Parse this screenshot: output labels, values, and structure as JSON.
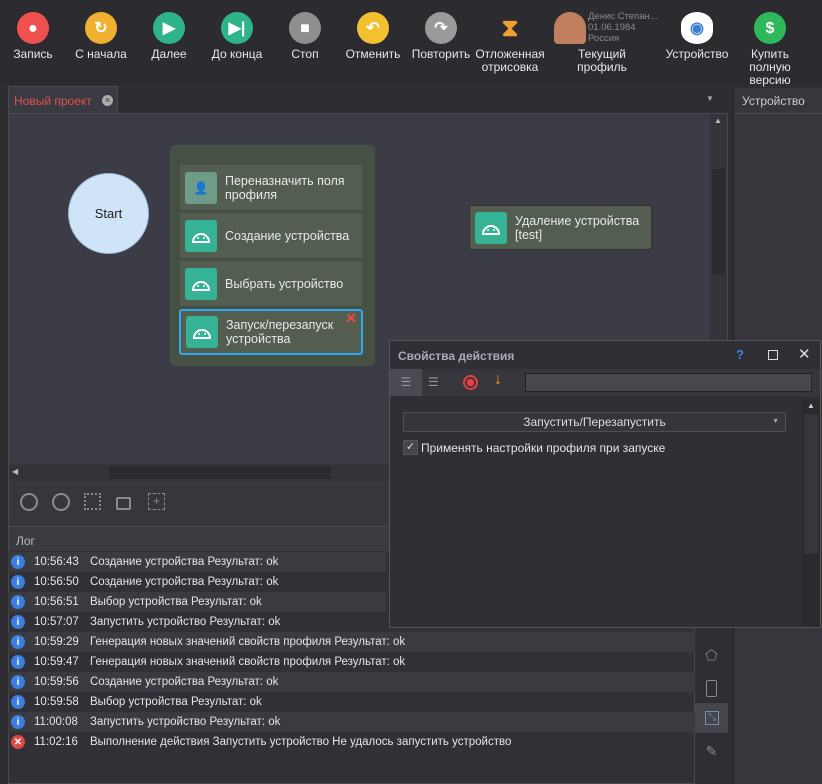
{
  "toolbar": {
    "items": [
      {
        "label": "Запись",
        "icon": "record-icon",
        "color": "#f05050"
      },
      {
        "label": "С начала",
        "icon": "restart-icon",
        "color": "#f0b030"
      },
      {
        "label": "Далее",
        "icon": "play-icon",
        "color": "#2fb38a"
      },
      {
        "label": "До конца",
        "icon": "skip-end-icon",
        "color": "#2fb38a"
      },
      {
        "label": "Стоп",
        "icon": "stop-icon",
        "color": "#8e8e8e"
      },
      {
        "label": "Отменить",
        "icon": "undo-icon",
        "color": "#f5c030"
      },
      {
        "label": "Повторить",
        "icon": "redo-icon",
        "color": "#9a9a9a"
      },
      {
        "label": "Отложенная отрисовка",
        "icon": "hourglass-icon"
      },
      {
        "label": "Текущий профиль",
        "icon": "profile-avatar-icon"
      },
      {
        "label": "Устройство",
        "icon": "eye-icon"
      },
      {
        "label": "Купить полную версию",
        "icon": "dollar-icon",
        "color": "#2eb85c"
      }
    ],
    "profile": {
      "name": "Денис Степан...",
      "date": "01.06.1984",
      "country": "Россия"
    }
  },
  "tabs": {
    "active": "Новый проект",
    "right_panel": "Устройство"
  },
  "canvas": {
    "start": "Start",
    "group": [
      "Переназначить поля профиля",
      "Создание устройства",
      "Выбрать устройство",
      "Запуск/перезапуск устройства"
    ],
    "standalone": "Удаление устройства [test]"
  },
  "dialog": {
    "title": "Свойства действия",
    "help": "?",
    "select_value": "Запустить/Перезапустить",
    "checkbox_label": "Применять настройки профиля при запуске",
    "checkbox_checked": true
  },
  "log": {
    "title": "Лог",
    "rows": [
      {
        "time": "10:56:43",
        "text": "Создание устройства  Результат: ok",
        "type": "info"
      },
      {
        "time": "10:56:50",
        "text": "Создание устройства  Результат: ok",
        "type": "info"
      },
      {
        "time": "10:56:51",
        "text": "Выбор устройства  Результат: ok",
        "type": "info"
      },
      {
        "time": "10:57:07",
        "text": "Запустить устройство  Результат: ok",
        "type": "info"
      },
      {
        "time": "10:59:29",
        "text": "Генерация новых значений свойств профиля  Результат: ok",
        "type": "info"
      },
      {
        "time": "10:59:47",
        "text": "Генерация новых значений свойств профиля  Результат: ok",
        "type": "info"
      },
      {
        "time": "10:59:56",
        "text": "Создание устройства  Результат: ok",
        "type": "info"
      },
      {
        "time": "10:59:58",
        "text": "Выбор устройства  Результат: ok",
        "type": "info"
      },
      {
        "time": "11:00:08",
        "text": "Запустить устройство  Результат: ok",
        "type": "info"
      },
      {
        "time": "11:02:16",
        "text": "Выполнение действия Запустить устройство Не удалось запустить устройство",
        "type": "error"
      }
    ]
  }
}
